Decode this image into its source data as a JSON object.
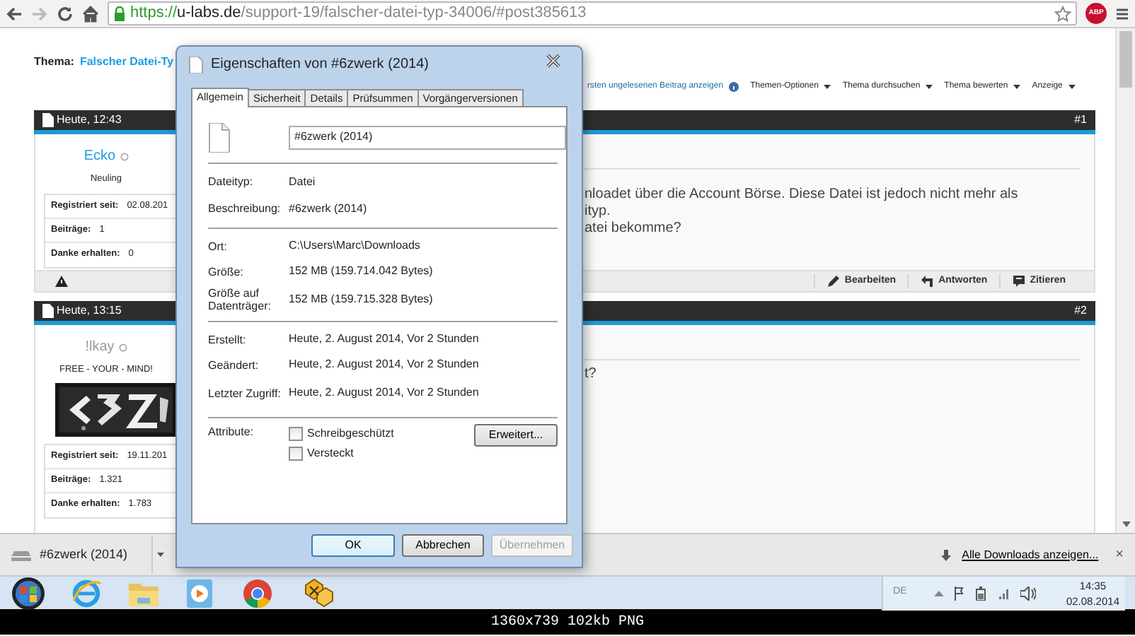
{
  "browser": {
    "url_scheme": "https://",
    "url_host": "u-labs.de",
    "url_path": "/support-19/falscher-datei-typ-34006/#post385613",
    "extension_label": "ABP"
  },
  "thread": {
    "label": "Thema:",
    "title": "Falscher Datei-Ty"
  },
  "thread_toolbar": [
    {
      "label": "rsten ungelesenen Beitrag anzeigen",
      "kind": "link"
    },
    {
      "label": "Themen-Optionen",
      "kind": "menu"
    },
    {
      "label": "Thema durchsuchen",
      "kind": "menu"
    },
    {
      "label": "Thema bewerten",
      "kind": "menu"
    },
    {
      "label": "Anzeige",
      "kind": "menu"
    }
  ],
  "posts": [
    {
      "date": "Heute, 12:43",
      "number": "#1",
      "author": {
        "name": "Ecko",
        "color": "#1a9ee0"
      },
      "rank": "Neuling",
      "stats": [
        {
          "label": "Registriert seit:",
          "value": "02.08.201"
        },
        {
          "label": "Beiträge:",
          "value": "1"
        },
        {
          "label": "Danke erhalten:",
          "value": "0"
        }
      ],
      "body_lines": [
        "nloadet über die Account Börse. Diese Datei ist jedoch nicht mehr als",
        "ityp.",
        "atei bekomme?"
      ],
      "actions": [
        {
          "label": "Bearbeiten",
          "kind": "edit"
        },
        {
          "label": "Antworten",
          "kind": "reply"
        },
        {
          "label": "Zitieren",
          "kind": "quote"
        }
      ]
    },
    {
      "date": "Heute, 13:15",
      "number": "#2",
      "author": {
        "name": "!lkay",
        "color": "#9a9a9a"
      },
      "rank": "FREE - YOUR - MIND!",
      "avatar": {
        "kind": "picture"
      },
      "stats": [
        {
          "label": "Registriert seit:",
          "value": "19.11.201"
        },
        {
          "label": "Beiträge:",
          "value": "1.321"
        },
        {
          "label": "Danke erhalten:",
          "value": "1.783"
        }
      ],
      "body_lines": [
        "t?"
      ]
    }
  ],
  "dialog": {
    "title": "Eigenschaften von #6zwerk (2014)",
    "tabs": [
      {
        "label": "Allgemein",
        "selected": true
      },
      {
        "label": "Sicherheit",
        "selected": false
      },
      {
        "label": "Details",
        "selected": false
      },
      {
        "label": "Prüfsummen",
        "selected": false
      },
      {
        "label": "Vorgängerversionen",
        "selected": false
      }
    ],
    "file_name": "#6zwerk (2014)",
    "groups": [
      [
        {
          "label": "Dateityp:",
          "value": "Datei"
        },
        {
          "label": "Beschreibung:",
          "value": "#6zwerk (2014)"
        }
      ],
      [
        {
          "label": "Ort:",
          "value": "C:\\Users\\Marc\\Downloads"
        },
        {
          "label": "Größe:",
          "value": "152 MB (159.714.042 Bytes)"
        },
        {
          "label": "Größe auf Datenträger:",
          "value": "152 MB (159.715.328 Bytes)"
        }
      ],
      [
        {
          "label": "Erstellt:",
          "value": "Heute, 2. August 2014, Vor 2 Stunden"
        },
        {
          "label": "Geändert:",
          "value": "Heute, 2. August 2014, Vor 2 Stunden"
        },
        {
          "label": "Letzter Zugriff:",
          "value": "Heute, 2. August 2014, Vor 2 Stunden"
        }
      ]
    ],
    "attributes_label": "Attribute:",
    "attributes": [
      {
        "label": "Schreibgeschützt",
        "checked": false
      },
      {
        "label": "Versteckt",
        "checked": false
      }
    ],
    "advanced_button": "Erweitert...",
    "buttons": [
      {
        "label": "OK",
        "default": true,
        "disabled": false
      },
      {
        "label": "Abbrechen",
        "default": false,
        "disabled": false
      },
      {
        "label": "Übernehmen",
        "default": false,
        "disabled": true
      }
    ]
  },
  "downloads": {
    "item": "#6zwerk (2014)",
    "show_all": "Alle Downloads anzeigen...",
    "close": "×"
  },
  "taskbar": {
    "language": "DE",
    "time": "14:35",
    "date": "02.08.2014"
  },
  "viewer_caption": "1360x739 102kb PNG"
}
